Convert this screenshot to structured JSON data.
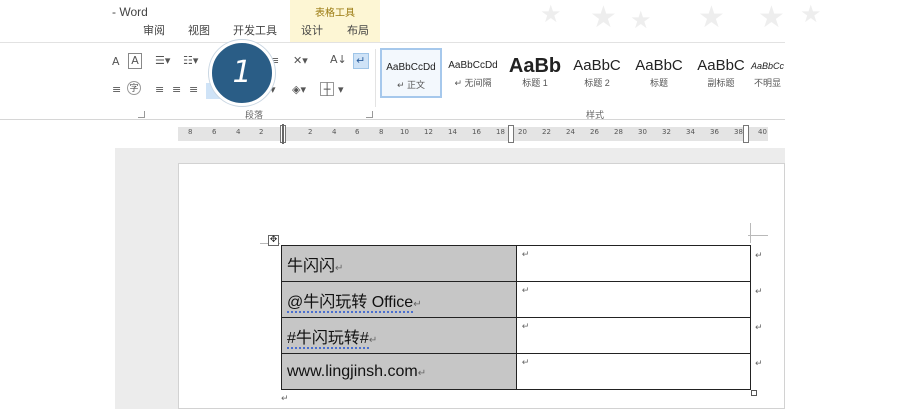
{
  "window": {
    "title": "- Word"
  },
  "tabs": [
    {
      "label": "审阅"
    },
    {
      "label": "视图"
    },
    {
      "label": "开发工具"
    },
    {
      "label": "设计"
    },
    {
      "label": "布局"
    }
  ],
  "context_group": {
    "label": "表格工具"
  },
  "ribbon": {
    "paragraph_label": "段落",
    "styles_label": "样式",
    "styles": [
      {
        "sample": "AaBbCcDd",
        "name": "↵ 正文",
        "selected": true
      },
      {
        "sample": "AaBbCcDd",
        "name": "↵ 无间隔"
      },
      {
        "sample": "AaBb",
        "name": "标题 1"
      },
      {
        "sample": "AaBbC",
        "name": "标题 2"
      },
      {
        "sample": "AaBbC",
        "name": "标题"
      },
      {
        "sample": "AaBbC",
        "name": "副标题"
      },
      {
        "sample": "AaBbCc",
        "name": "不明显"
      }
    ]
  },
  "step_badge": {
    "number": "1"
  },
  "ruler": {
    "left_numbers": [
      "8",
      "6",
      "4",
      "2"
    ],
    "right_numbers": [
      "2",
      "4",
      "6",
      "8",
      "10",
      "12",
      "14",
      "16",
      "18",
      "20",
      "22",
      "24",
      "26",
      "28",
      "30",
      "32",
      "34",
      "36",
      "38",
      "40"
    ]
  },
  "document": {
    "table_rows": [
      {
        "left": "牛闪闪",
        "right": ""
      },
      {
        "left": "@牛闪玩转 Office",
        "right": ""
      },
      {
        "left": "#牛闪玩转#",
        "right": ""
      },
      {
        "left": "www.lingjinsh.com",
        "right": ""
      }
    ],
    "paragraph_mark": "↵",
    "move_handle": "✥"
  }
}
